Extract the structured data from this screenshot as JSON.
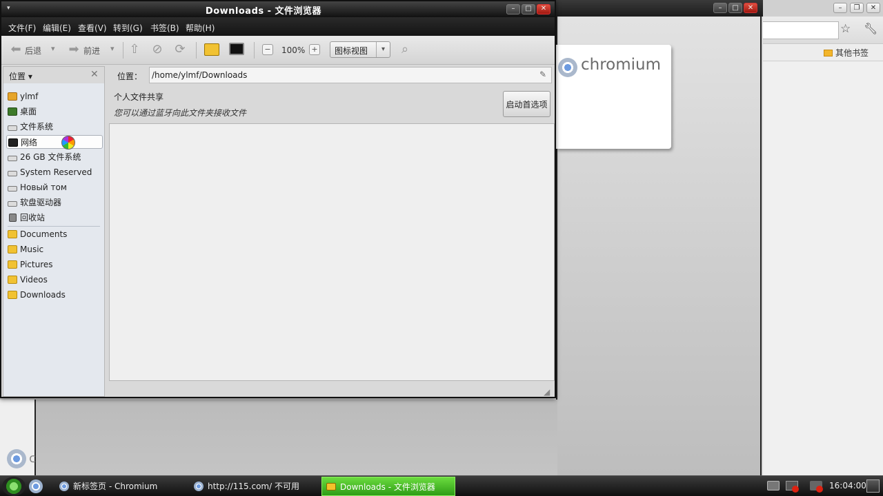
{
  "window": {
    "title": "Downloads - 文件浏览器"
  },
  "menubar": {
    "items": [
      "文件(F)",
      "编辑(E)",
      "查看(V)",
      "转到(G)",
      "书签(B)",
      "帮助(H)"
    ]
  },
  "toolbar": {
    "back_label": "后退",
    "forward_label": "前进",
    "zoom_level": "100%",
    "view_mode": "图标视图"
  },
  "sidebar": {
    "title": "位置",
    "items": [
      {
        "label": "ylmf",
        "icon": "home-folder-icon"
      },
      {
        "label": "桌面",
        "icon": "desktop-icon"
      },
      {
        "label": "文件系统",
        "icon": "drive-icon"
      },
      {
        "label": "网络",
        "icon": "network-icon"
      },
      {
        "label": "26 GB 文件系统",
        "icon": "drive-icon"
      },
      {
        "label": "System Reserved",
        "icon": "drive-icon"
      },
      {
        "label": "Новый том",
        "icon": "drive-icon"
      },
      {
        "label": "软盘驱动器",
        "icon": "drive-icon"
      },
      {
        "label": "回收站",
        "icon": "trash-icon"
      },
      {
        "label": "Documents",
        "icon": "folder-icon"
      },
      {
        "label": "Music",
        "icon": "folder-icon"
      },
      {
        "label": "Pictures",
        "icon": "folder-icon"
      },
      {
        "label": "Videos",
        "icon": "folder-icon"
      },
      {
        "label": "Downloads",
        "icon": "folder-icon"
      }
    ]
  },
  "location": {
    "label": "位置：",
    "path": "/home/ylmf/Downloads"
  },
  "share": {
    "title": "个人文件共享",
    "description": "您可以通过蓝牙向此文件夹接收文件",
    "button_label": "启动首选项"
  },
  "background_browser": {
    "logo_text": "chromium",
    "other_bookmarks": "其他书签",
    "partial_logo_text": "c"
  },
  "taskbar": {
    "tasks": [
      {
        "label": "新标签页 - Chromium"
      },
      {
        "label": "http://115.com/ 不可用"
      },
      {
        "label": "Downloads - 文件浏览器"
      }
    ],
    "clock": "16:04:00"
  },
  "colors": {
    "active_task": "#4fc22a",
    "titlebar": "#222222",
    "close_button": "#c8321e"
  }
}
